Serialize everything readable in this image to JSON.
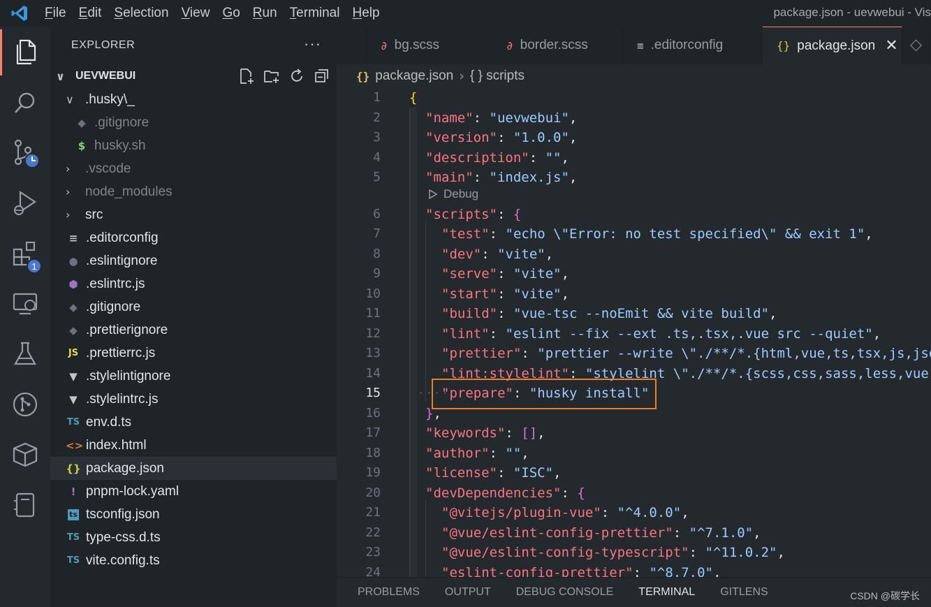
{
  "menu": [
    {
      "first": "F",
      "rest": "ile"
    },
    {
      "first": "E",
      "rest": "dit"
    },
    {
      "first": "S",
      "rest": "election"
    },
    {
      "first": "V",
      "rest": "iew"
    },
    {
      "first": "G",
      "rest": "o"
    },
    {
      "first": "R",
      "rest": "un"
    },
    {
      "first": "T",
      "rest": "erminal"
    },
    {
      "first": "H",
      "rest": "elp"
    }
  ],
  "window_title": "package.json - uevwebui - Vis",
  "activity": {
    "extensions_badge": "1"
  },
  "sidebar": {
    "title": "EXPLORER",
    "more": "···",
    "section": "UEVWEBUI",
    "items": [
      {
        "chev": "∨",
        "icon": "",
        "label": ".husky\\_",
        "depth": 0,
        "dim": false
      },
      {
        "chev": "",
        "icon": "◆",
        "label": ".gitignore",
        "depth": 1,
        "dim": true
      },
      {
        "chev": "",
        "icon": "$",
        "label": "husky.sh",
        "depth": 1,
        "dim": true
      },
      {
        "chev": "›",
        "icon": "",
        "label": ".vscode",
        "depth": 0,
        "dim": true
      },
      {
        "chev": "›",
        "icon": "",
        "label": "node_modules",
        "depth": 0,
        "dim": true
      },
      {
        "chev": "›",
        "icon": "",
        "label": "src",
        "depth": 0,
        "dim": false
      },
      {
        "chev": "",
        "icon": "≡",
        "label": ".editorconfig",
        "depth": 0,
        "dim": false
      },
      {
        "chev": "",
        "icon": "●",
        "label": ".eslintignore",
        "depth": 0,
        "dim": false
      },
      {
        "chev": "",
        "icon": "⬢",
        "label": ".eslintrc.js",
        "depth": 0,
        "dim": false
      },
      {
        "chev": "",
        "icon": "◆",
        "label": ".gitignore",
        "depth": 0,
        "dim": false
      },
      {
        "chev": "",
        "icon": "◆",
        "label": ".prettierignore",
        "depth": 0,
        "dim": false
      },
      {
        "chev": "",
        "icon": "JS",
        "label": ".prettierrc.js",
        "depth": 0,
        "dim": false
      },
      {
        "chev": "",
        "icon": "▼",
        "label": ".stylelintignore",
        "depth": 0,
        "dim": false
      },
      {
        "chev": "",
        "icon": "▼",
        "label": ".stylelintrc.js",
        "depth": 0,
        "dim": false
      },
      {
        "chev": "",
        "icon": "TS",
        "label": "env.d.ts",
        "depth": 0,
        "dim": false
      },
      {
        "chev": "",
        "icon": "<>",
        "label": "index.html",
        "depth": 0,
        "dim": false
      },
      {
        "chev": "",
        "icon": "{}",
        "label": "package.json",
        "depth": 0,
        "dim": false,
        "selected": true
      },
      {
        "chev": "",
        "icon": "!",
        "label": "pnpm-lock.yaml",
        "depth": 0,
        "dim": false
      },
      {
        "chev": "",
        "icon": "ts",
        "label": "tsconfig.json",
        "depth": 0,
        "dim": false
      },
      {
        "chev": "",
        "icon": "TS",
        "label": "type-css.d.ts",
        "depth": 0,
        "dim": false
      },
      {
        "chev": "",
        "icon": "TS",
        "label": "vite.config.ts",
        "depth": 0,
        "dim": false
      }
    ]
  },
  "tabs": [
    {
      "icon": "∂",
      "label": "bg.scss",
      "active": false
    },
    {
      "icon": "∂",
      "label": "border.scss",
      "active": false
    },
    {
      "icon": "≡",
      "label": ".editorconfig",
      "active": false
    },
    {
      "icon": "{}",
      "label": "package.json",
      "active": true,
      "close": "✕"
    }
  ],
  "breadcrumb": {
    "file": "package.json",
    "sep": "›",
    "node": "{ } scripts"
  },
  "editor": {
    "current_line": 15,
    "codelens_text": "Debug",
    "lines": [
      {
        "n": 1,
        "indent": 0,
        "tokens": [
          [
            "b1",
            "{"
          ]
        ]
      },
      {
        "n": 2,
        "indent": 1,
        "tokens": [
          [
            "k",
            "\"name\""
          ],
          [
            "p",
            ": "
          ],
          [
            "s",
            "\"uevwebui\""
          ],
          [
            "p",
            ","
          ]
        ]
      },
      {
        "n": 3,
        "indent": 1,
        "tokens": [
          [
            "k",
            "\"version\""
          ],
          [
            "p",
            ": "
          ],
          [
            "s",
            "\"1.0.0\""
          ],
          [
            "p",
            ","
          ]
        ]
      },
      {
        "n": 4,
        "indent": 1,
        "tokens": [
          [
            "k",
            "\"description\""
          ],
          [
            "p",
            ": "
          ],
          [
            "s",
            "\"\""
          ],
          [
            "p",
            ","
          ]
        ]
      },
      {
        "n": 5,
        "indent": 1,
        "tokens": [
          [
            "k",
            "\"main\""
          ],
          [
            "p",
            ": "
          ],
          [
            "s",
            "\"index.js\""
          ],
          [
            "p",
            ","
          ]
        ]
      },
      {
        "n": 6,
        "indent": 1,
        "tokens": [
          [
            "k",
            "\"scripts\""
          ],
          [
            "p",
            ": "
          ],
          [
            "b2",
            "{"
          ]
        ]
      },
      {
        "n": 7,
        "indent": 2,
        "tokens": [
          [
            "k",
            "\"test\""
          ],
          [
            "p",
            ": "
          ],
          [
            "s",
            "\"echo \\\"Error: no test specified\\\" && exit 1\""
          ],
          [
            "p",
            ","
          ]
        ]
      },
      {
        "n": 8,
        "indent": 2,
        "tokens": [
          [
            "k",
            "\"dev\""
          ],
          [
            "p",
            ": "
          ],
          [
            "s",
            "\"vite\""
          ],
          [
            "p",
            ","
          ]
        ]
      },
      {
        "n": 9,
        "indent": 2,
        "tokens": [
          [
            "k",
            "\"serve\""
          ],
          [
            "p",
            ": "
          ],
          [
            "s",
            "\"vite\""
          ],
          [
            "p",
            ","
          ]
        ]
      },
      {
        "n": 10,
        "indent": 2,
        "tokens": [
          [
            "k",
            "\"start\""
          ],
          [
            "p",
            ": "
          ],
          [
            "s",
            "\"vite\""
          ],
          [
            "p",
            ","
          ]
        ]
      },
      {
        "n": 11,
        "indent": 2,
        "tokens": [
          [
            "k",
            "\"build\""
          ],
          [
            "p",
            ": "
          ],
          [
            "s",
            "\"vue-tsc --noEmit && vite build\""
          ],
          [
            "p",
            ","
          ]
        ]
      },
      {
        "n": 12,
        "indent": 2,
        "tokens": [
          [
            "k",
            "\"lint\""
          ],
          [
            "p",
            ": "
          ],
          [
            "s",
            "\"eslint --fix --ext .ts,.tsx,.vue src --quiet\""
          ],
          [
            "p",
            ","
          ]
        ]
      },
      {
        "n": 13,
        "indent": 2,
        "tokens": [
          [
            "k",
            "\"prettier\""
          ],
          [
            "p",
            ": "
          ],
          [
            "s",
            "\"prettier --write \\\"./**/*.{html,vue,ts,tsx,js,json,md}\\\"\""
          ],
          [
            "p",
            ","
          ]
        ]
      },
      {
        "n": 14,
        "indent": 2,
        "tokens": [
          [
            "k",
            "\"lint:stylelint\""
          ],
          [
            "p",
            ": "
          ],
          [
            "s",
            "\"stylelint \\\"./**/*.{scss,css,sass,less,vue,html}\\\" --fix\""
          ],
          [
            "p",
            ","
          ]
        ]
      },
      {
        "n": 15,
        "indent": 2,
        "ws": "····",
        "tokens": [
          [
            "k",
            "\"prepare\""
          ],
          [
            "p",
            ": "
          ],
          [
            "s",
            "\"husky install\""
          ]
        ]
      },
      {
        "n": 16,
        "indent": 1,
        "tokens": [
          [
            "b2",
            "}"
          ],
          [
            "p",
            ","
          ]
        ]
      },
      {
        "n": 17,
        "indent": 1,
        "tokens": [
          [
            "k",
            "\"keywords\""
          ],
          [
            "p",
            ": "
          ],
          [
            "b2",
            "[]"
          ],
          [
            "p",
            ","
          ]
        ]
      },
      {
        "n": 18,
        "indent": 1,
        "tokens": [
          [
            "k",
            "\"author\""
          ],
          [
            "p",
            ": "
          ],
          [
            "s",
            "\"\""
          ],
          [
            "p",
            ","
          ]
        ]
      },
      {
        "n": 19,
        "indent": 1,
        "tokens": [
          [
            "k",
            "\"license\""
          ],
          [
            "p",
            ": "
          ],
          [
            "s",
            "\"ISC\""
          ],
          [
            "p",
            ","
          ]
        ]
      },
      {
        "n": 20,
        "indent": 1,
        "tokens": [
          [
            "k",
            "\"devDependencies\""
          ],
          [
            "p",
            ": "
          ],
          [
            "b2",
            "{"
          ]
        ]
      },
      {
        "n": 21,
        "indent": 2,
        "tokens": [
          [
            "k",
            "\"@vitejs/plugin-vue\""
          ],
          [
            "p",
            ": "
          ],
          [
            "s",
            "\"^4.0.0\""
          ],
          [
            "p",
            ","
          ]
        ]
      },
      {
        "n": 22,
        "indent": 2,
        "tokens": [
          [
            "k",
            "\"@vue/eslint-config-prettier\""
          ],
          [
            "p",
            ": "
          ],
          [
            "s",
            "\"^7.1.0\""
          ],
          [
            "p",
            ","
          ]
        ]
      },
      {
        "n": 23,
        "indent": 2,
        "tokens": [
          [
            "k",
            "\"@vue/eslint-config-typescript\""
          ],
          [
            "p",
            ": "
          ],
          [
            "s",
            "\"^11.0.2\""
          ],
          [
            "p",
            ","
          ]
        ]
      },
      {
        "n": 24,
        "indent": 2,
        "tokens": [
          [
            "k",
            "\"eslint-config-prettier\""
          ],
          [
            "p",
            ": "
          ],
          [
            "s",
            "\"^8.7.0\""
          ],
          [
            "p",
            ","
          ]
        ]
      }
    ]
  },
  "panel": {
    "tabs": [
      "PROBLEMS",
      "OUTPUT",
      "DEBUG CONSOLE",
      "TERMINAL",
      "GITLENS"
    ],
    "active": "TERMINAL",
    "watermark": "CSDN @碳学长"
  },
  "colors": {
    "accent": "#f9826c",
    "highlight_box": "#e8802c",
    "key": "#f97583",
    "string": "#9ecbff"
  }
}
